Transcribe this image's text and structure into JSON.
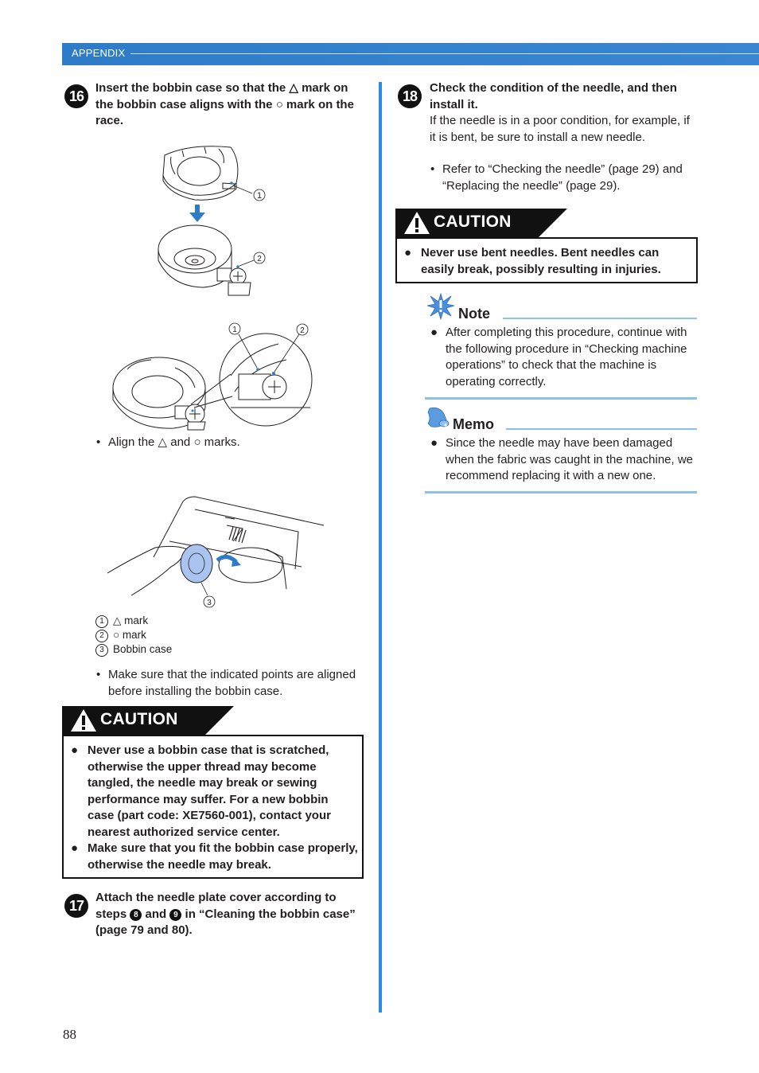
{
  "header": {
    "section": "APPENDIX",
    "accent_color": "#2e7cc8"
  },
  "left_column": {
    "step16": {
      "number": "16",
      "instruction": "Insert the bobbin case so that the △ mark on the bobbin case aligns with the ○ mark on the race.",
      "figure1_callouts": [
        "①",
        "②"
      ],
      "figure2_callouts": [
        "①",
        "②"
      ],
      "align_note": "Align the △ and ○ marks.",
      "figure3_callouts": [
        "③"
      ],
      "legend": [
        {
          "num": "1",
          "text": "△ mark"
        },
        {
          "num": "2",
          "text": "○ mark"
        },
        {
          "num": "3",
          "text": "Bobbin case"
        }
      ],
      "make_sure_note": "Make sure that the indicated points are aligned before installing the bobbin case."
    },
    "caution": {
      "title": "CAUTION",
      "items": [
        "Never use a bobbin case that is scratched, otherwise the upper thread may become tangled, the needle may break or sewing performance may suffer. For a new bobbin case (part code: XE7560-001), contact your nearest authorized service center.",
        "Make sure that you fit the bobbin case properly, otherwise the needle may break."
      ]
    },
    "step17": {
      "number": "17",
      "instruction_part1": "Attach the needle plate cover according to steps ",
      "ref_a": "8",
      "instruction_part2": " and ",
      "ref_b": "9",
      "instruction_part3": " in “Cleaning the bobbin case” (page 79 and 80)."
    }
  },
  "right_column": {
    "step18": {
      "number": "18",
      "instruction": "Check the condition of the needle, and then install it.",
      "body": "If the needle is in a poor condition, for example, if it is bent, be sure to install a new needle.",
      "bullet": "Refer to “Checking the needle” (page 29) and “Replacing the needle” (page 29)."
    },
    "caution": {
      "title": "CAUTION",
      "items": [
        "Never use bent needles. Bent needles can easily break, possibly resulting in injuries."
      ]
    },
    "note": {
      "title": "Note",
      "icon": "note-burst-icon",
      "text": "After completing this procedure, continue with the following procedure in “Checking machine operations” to check that the machine is operating correctly."
    },
    "memo": {
      "title": "Memo",
      "icon": "memo-bell-icon",
      "text": "Since the needle may have been damaged when the fabric was caught in the machine, we recommend replacing it with a new one."
    }
  },
  "footer": {
    "page_number": "88"
  }
}
